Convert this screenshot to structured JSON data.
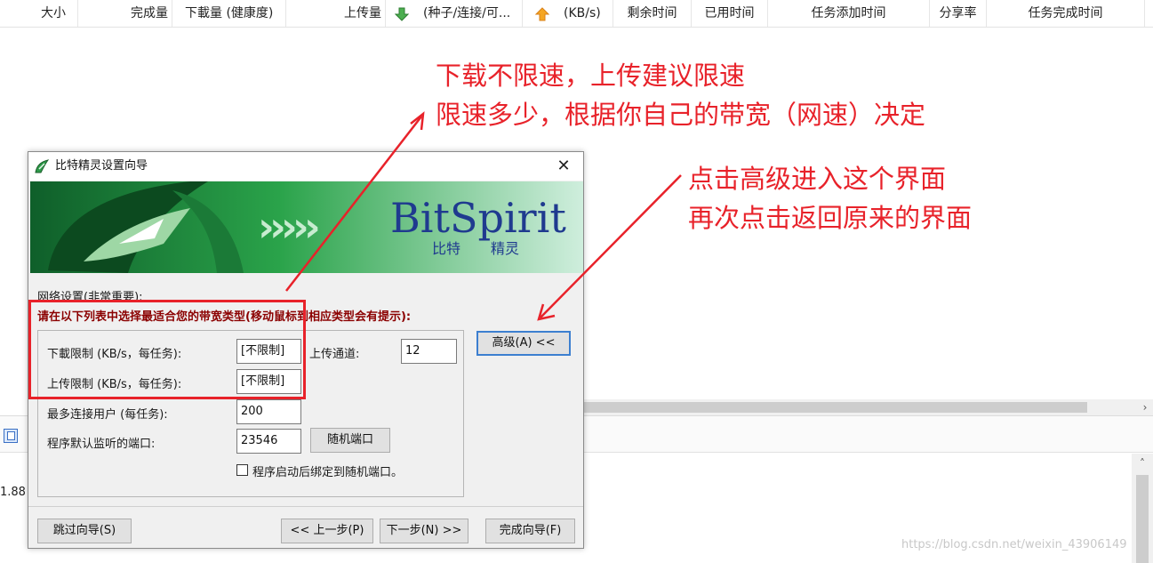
{
  "list_header": {
    "columns": [
      "大小",
      "完成量",
      "下載量 (健康度)",
      "上传量",
      "(种子/连接/可...",
      "(KB/s)",
      "剩余时间",
      "已用时间",
      "任务添加时间",
      "分享率",
      "任务完成时间"
    ]
  },
  "annotations": {
    "top": [
      "下载不限速，上传建议限速",
      "限速多少，根据你自己的带宽（网速）决定"
    ],
    "right": [
      "点击高级进入这个界面",
      "再次点击返回原来的界面"
    ],
    "color": "#e8222a"
  },
  "background": {
    "left_value": "1.88",
    "watermark": "https://blog.csdn.net/weixin_43906149",
    "scroll_right_glyph": "›",
    "scroll_up_glyph": "˄"
  },
  "dialog": {
    "title": "比特精灵设置向导",
    "close_glyph": "✕",
    "banner": {
      "brand": "BitSpirit",
      "brand_sub_left": "比特",
      "brand_sub_right": "精灵",
      "chevrons": "›››››",
      "bg_color": "#1d8a3b",
      "brand_color": "#1f3a8f"
    },
    "network_title": "网络设置(非常重要):",
    "bandwidth_hint": "请在以下列表中选择最适合您的带宽类型(移动鼠标到相应类型会有提示):",
    "download_limit": {
      "label": "下載限制 (KB/s，每任务):",
      "value": "[不限制]"
    },
    "upload_limit": {
      "label": "上传限制 (KB/s，每任务):",
      "value": "[不限制]"
    },
    "upload_slots": {
      "label": "上传通道:",
      "value": "12"
    },
    "max_connections": {
      "label": "最多连接用户 (每任务):",
      "value": "200"
    },
    "listen_port": {
      "label": "程序默认监听的端口:",
      "value": "23546"
    },
    "random_port_button": "随机端口",
    "bind_random_checkbox": {
      "label": "程序启动后绑定到随机端口。",
      "checked": false
    },
    "advanced_button": "高级(A) <<",
    "skip_button": "跳过向导(S)",
    "prev_button": "<< 上一步(P)",
    "next_button": "下一步(N) >>",
    "finish_button": "完成向导(F)"
  }
}
